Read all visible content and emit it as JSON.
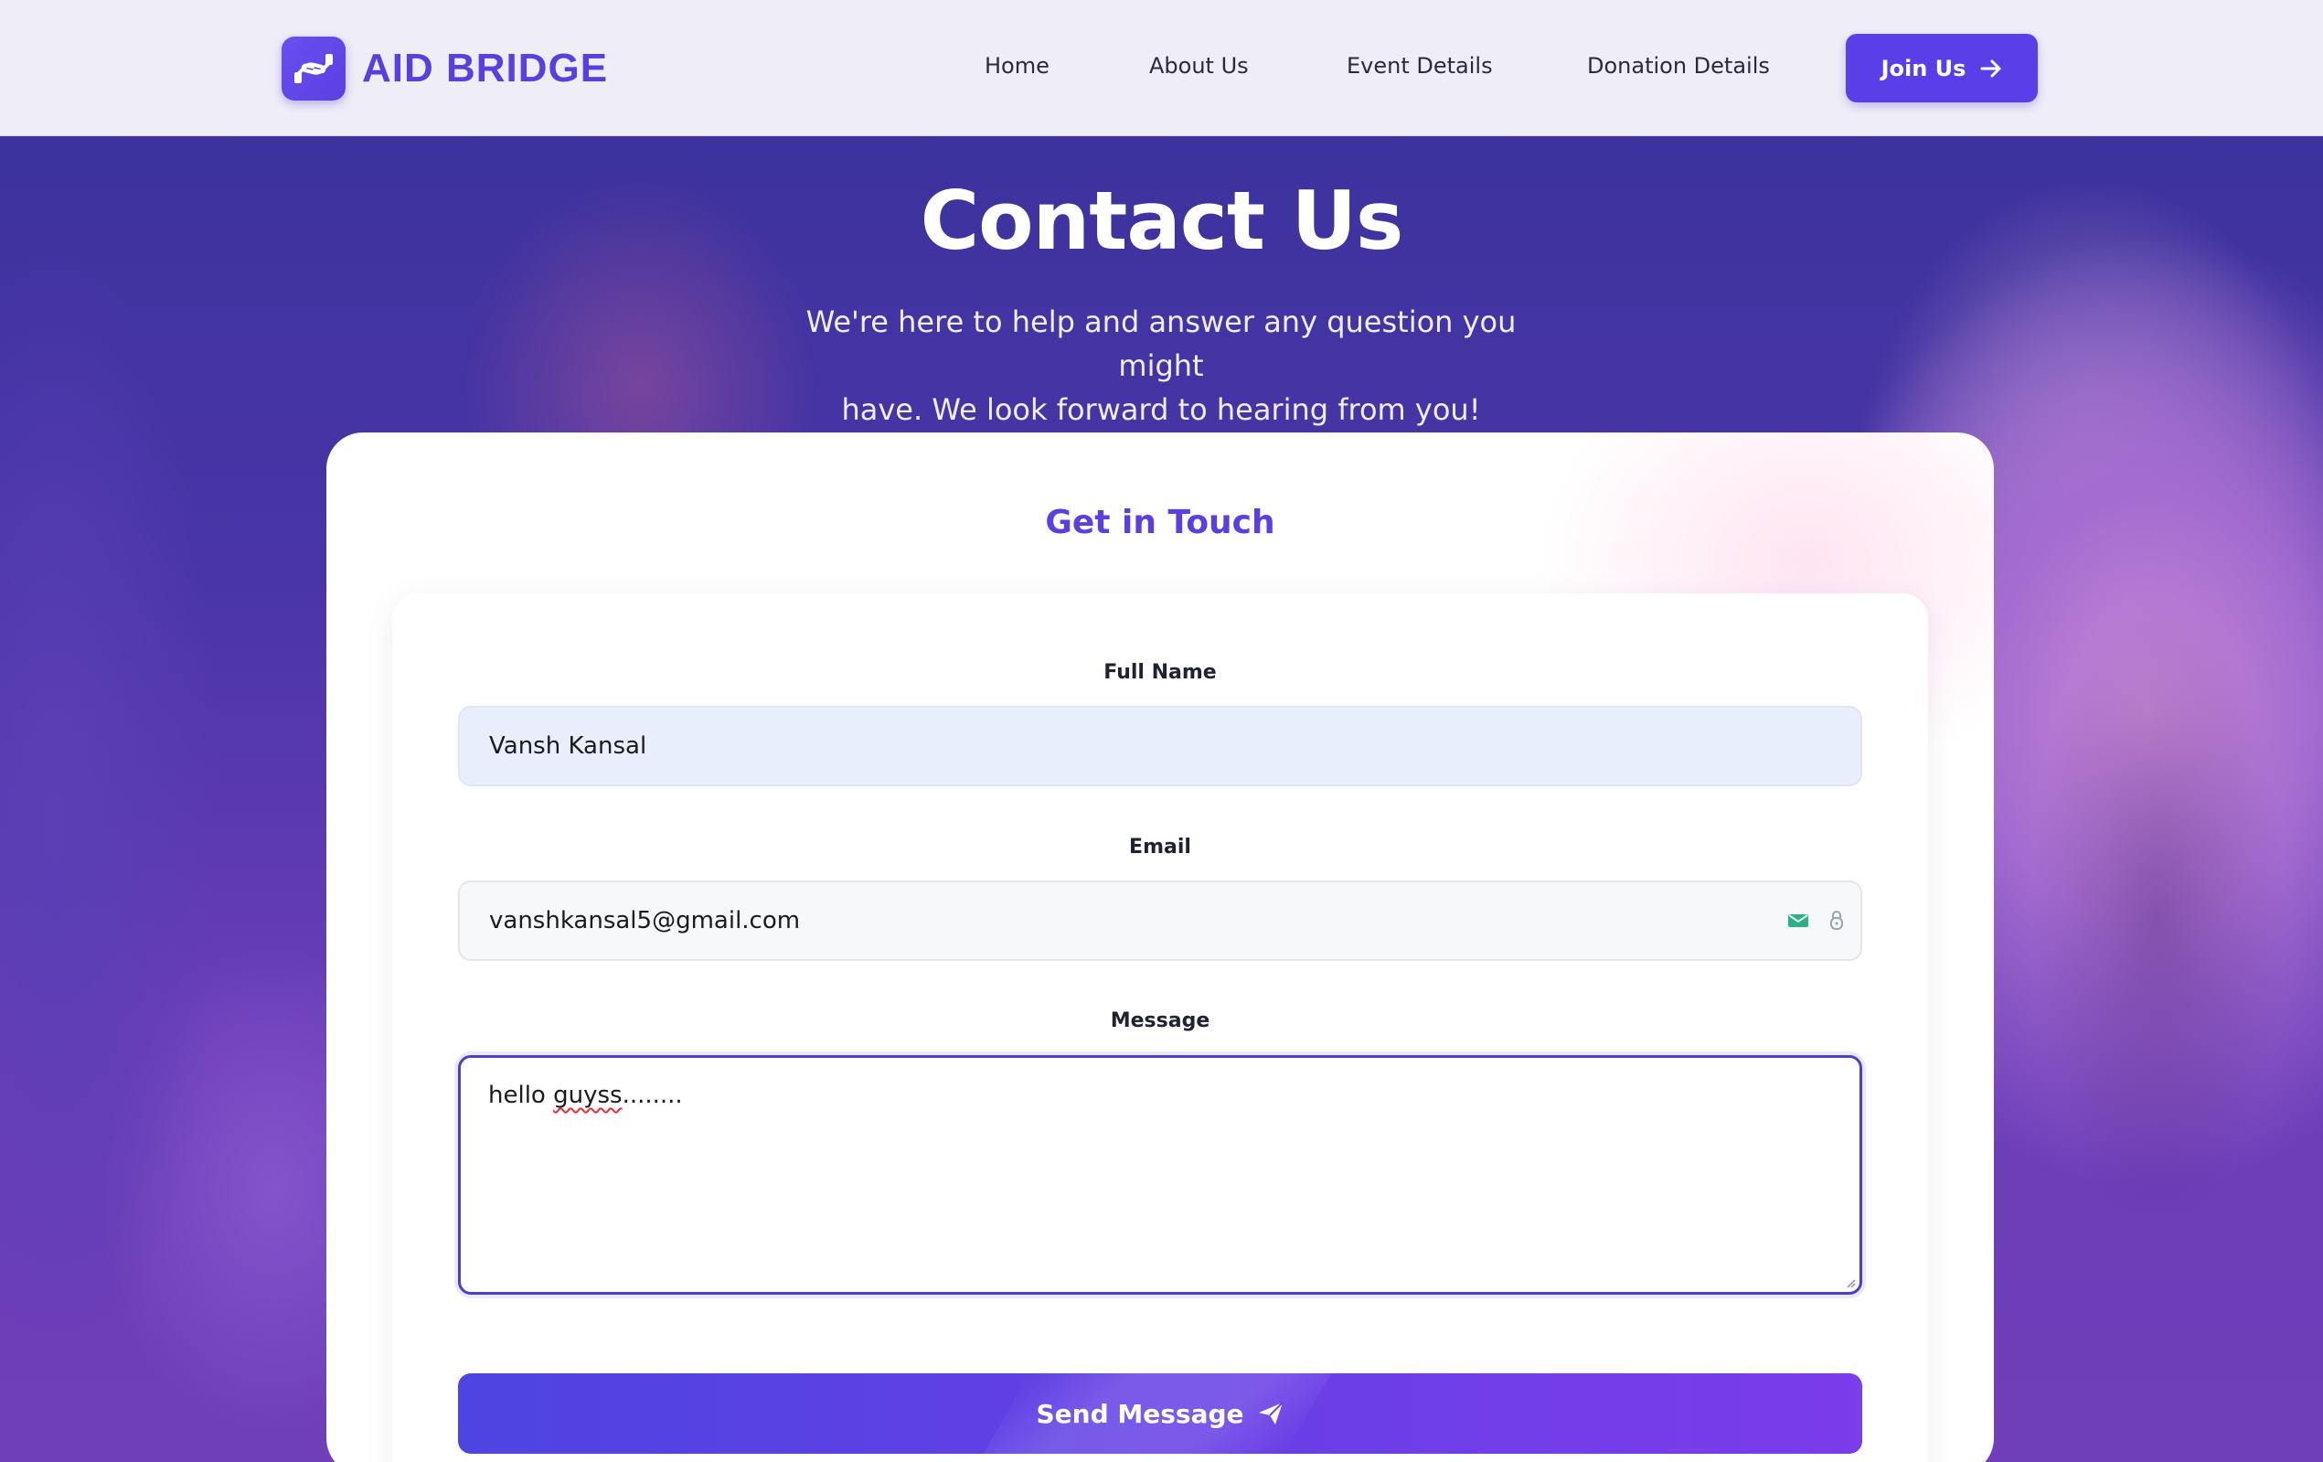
{
  "brand": {
    "name": "AID BRIDGE",
    "logo_icon": "helping-hands-icon"
  },
  "nav": {
    "items": [
      {
        "label": "Home"
      },
      {
        "label": "About Us"
      },
      {
        "label": "Event Details"
      },
      {
        "label": "Donation Details"
      }
    ],
    "join_label": "Join Us",
    "join_icon": "arrow-right-icon"
  },
  "hero": {
    "title": "Contact Us",
    "subtitle_line1": "We're here to help and answer any question you might",
    "subtitle_line2": "have. We look forward to hearing from you!"
  },
  "form": {
    "title": "Get in Touch",
    "name_label": "Full Name",
    "name_value": "Vansh Kansal",
    "email_label": "Email",
    "email_value": "vanshkansal5@gmail.com",
    "message_label": "Message",
    "message_word1": "hello ",
    "message_word2": "guyss",
    "message_rest": "........",
    "send_label": "Send Message",
    "send_icon": "paper-plane-icon"
  },
  "colors": {
    "accent": "#5a3fe8",
    "hero_bg": "#4a35a8",
    "card_bg": "#ffffff",
    "name_field_bg": "#e8eefb"
  }
}
